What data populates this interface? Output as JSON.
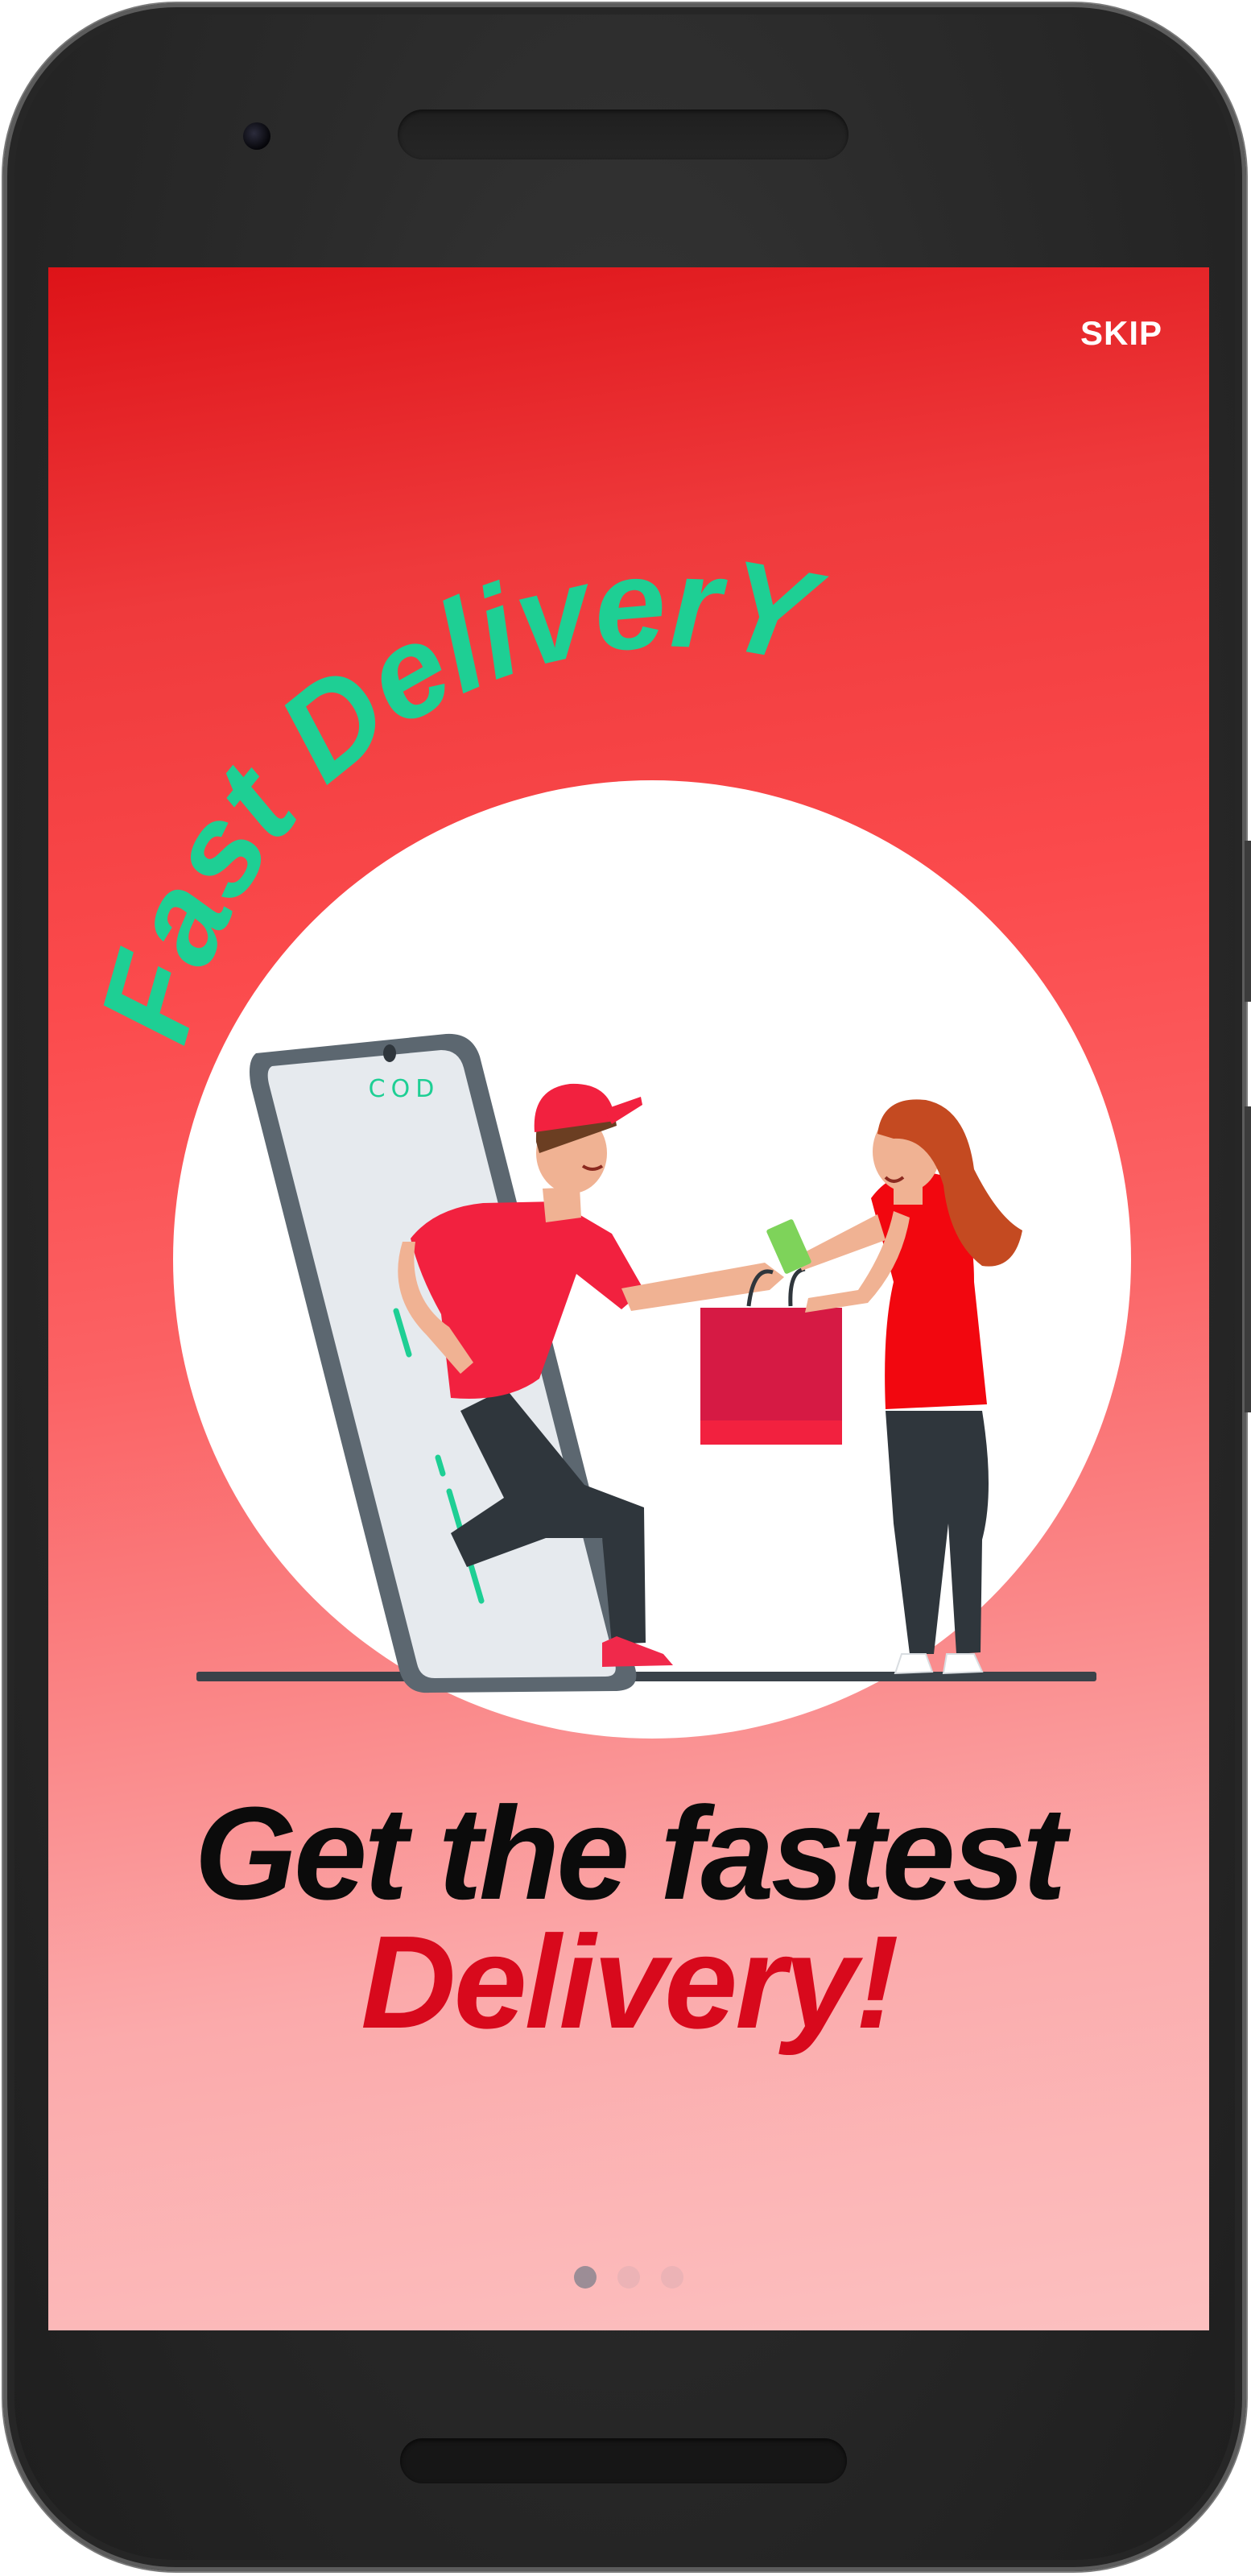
{
  "skip_label": "SKIP",
  "arc_text": "Fast DeliverY",
  "phone_label": "COD",
  "headline": {
    "line1": "Get the fastest",
    "line2": "Delivery!"
  },
  "pager": {
    "total": 3,
    "active_index": 0
  },
  "colors": {
    "brand_red": "#dd1318",
    "accent_green": "#1ecf94",
    "headline_black": "#0b0b0b",
    "headline_red": "#d8091c"
  }
}
